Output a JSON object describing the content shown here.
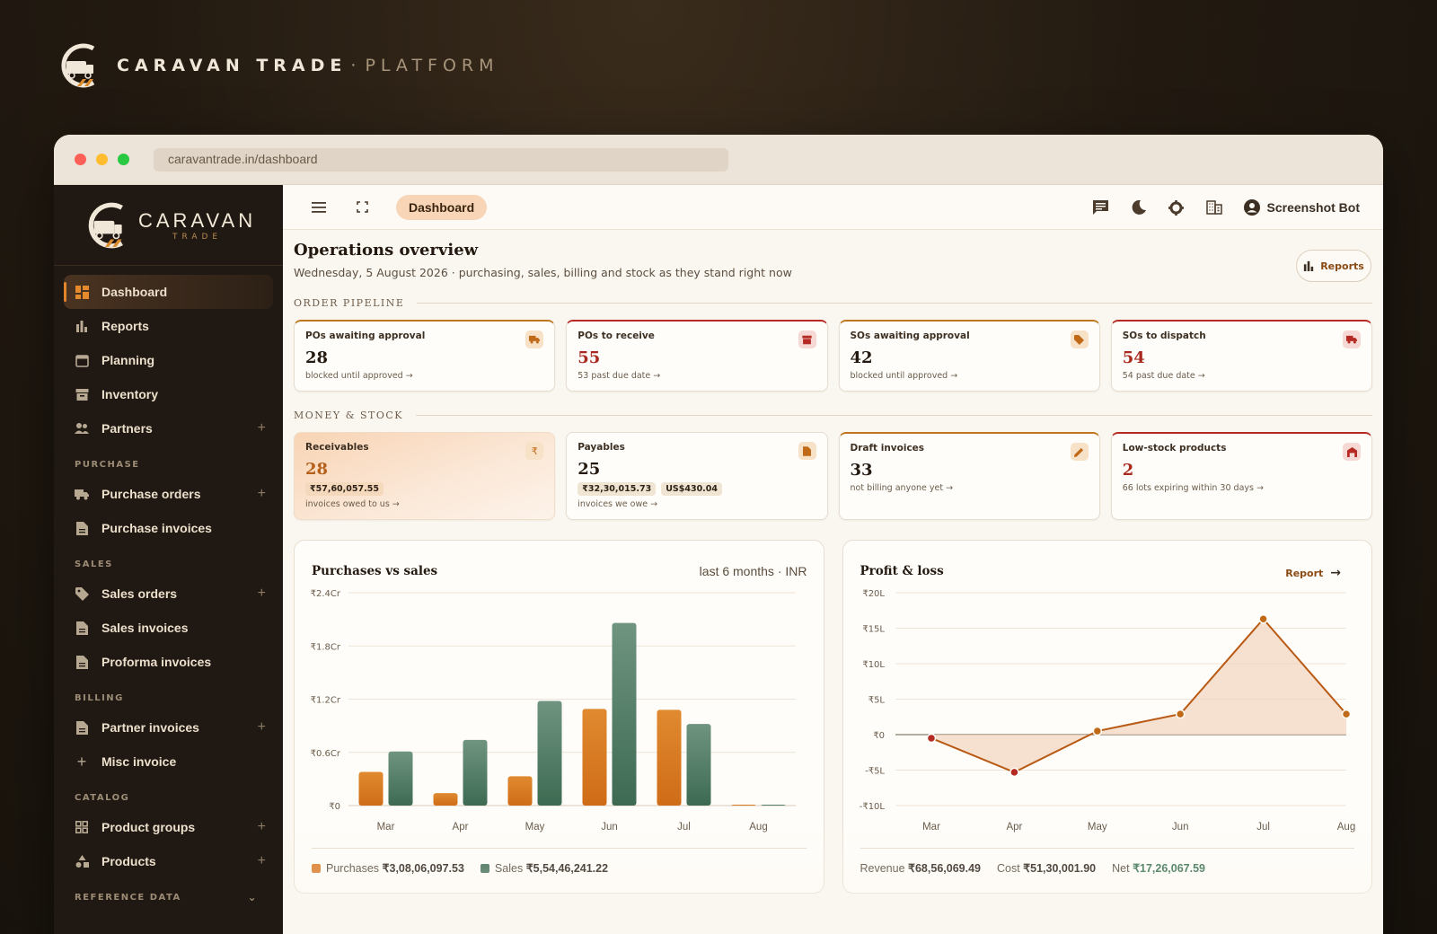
{
  "hero": {
    "brand": "CARAVAN TRADE",
    "separator": "·",
    "suffix": "PLATFORM"
  },
  "browser": {
    "url": "caravantrade.in/dashboard"
  },
  "sidebar": {
    "logo": {
      "name": "CARAVAN",
      "tagline": "TRADE"
    },
    "items_top": [
      {
        "label": "Dashboard",
        "icon": "dashboard-icon",
        "active": true
      },
      {
        "label": "Reports",
        "icon": "bar-chart-icon"
      },
      {
        "label": "Planning",
        "icon": "calendar-icon"
      },
      {
        "label": "Inventory",
        "icon": "archive-icon"
      },
      {
        "label": "Partners",
        "icon": "people-icon",
        "plus": true
      }
    ],
    "sections": {
      "purchase": "PURCHASE",
      "sales": "SALES",
      "billing": "BILLING",
      "catalog": "CATALOG",
      "reference": "REFERENCE DATA"
    },
    "purchase_items": [
      {
        "label": "Purchase orders",
        "icon": "truck-icon",
        "plus": true
      },
      {
        "label": "Purchase invoices",
        "icon": "document-icon"
      }
    ],
    "sales_items": [
      {
        "label": "Sales orders",
        "icon": "tag-icon",
        "plus": true
      },
      {
        "label": "Sales invoices",
        "icon": "document-icon"
      },
      {
        "label": "Proforma invoices",
        "icon": "document-icon"
      }
    ],
    "billing_items": [
      {
        "label": "Partner invoices",
        "icon": "document-icon",
        "plus": true
      },
      {
        "label": "Misc invoice",
        "icon": "plus-icon"
      }
    ],
    "catalog_items": [
      {
        "label": "Product groups",
        "icon": "grid-icon",
        "plus": true
      },
      {
        "label": "Products",
        "icon": "shapes-icon",
        "plus": true
      }
    ]
  },
  "topbar": {
    "tab": "Dashboard",
    "user": "Screenshot Bot"
  },
  "page": {
    "title": "Operations overview",
    "subtitle": "Wednesday, 5 August 2026 · purchasing, sales, billing and stock as they stand right now",
    "reports_button": "Reports"
  },
  "pipeline": {
    "heading": "ORDER PIPELINE",
    "cards": [
      {
        "label": "POs awaiting approval",
        "value": "28",
        "foot": "blocked until approved →",
        "icon": "truck-icon"
      },
      {
        "label": "POs to receive",
        "value": "55",
        "foot": "53 past due date →",
        "icon": "archive-icon"
      },
      {
        "label": "SOs awaiting approval",
        "value": "42",
        "foot": "blocked until approved →",
        "icon": "tag-icon"
      },
      {
        "label": "SOs to dispatch",
        "value": "54",
        "foot": "54 past due date →",
        "icon": "truck-icon"
      }
    ]
  },
  "money": {
    "heading": "MONEY & STOCK",
    "cards": [
      {
        "label": "Receivables",
        "value": "28",
        "tags": [
          "₹57,60,057.55"
        ],
        "foot": "invoices owed to us →",
        "icon": "rupee-icon"
      },
      {
        "label": "Payables",
        "value": "25",
        "tags": [
          "₹32,30,015.73",
          "US$430.04"
        ],
        "foot": "invoices we owe →",
        "icon": "document-icon"
      },
      {
        "label": "Draft invoices",
        "value": "33",
        "foot": "not billing anyone yet →",
        "icon": "pencil-icon"
      },
      {
        "label": "Low-stock products",
        "value": "2",
        "foot": "66 lots expiring within 30 days →",
        "icon": "warehouse-icon"
      }
    ]
  },
  "colors": {
    "purchases": "#d9771f",
    "sales": "#4f7a63",
    "profit_line": "#b85a14",
    "negative_dot": "#b52a22"
  },
  "chart_data": [
    {
      "type": "bar",
      "title": "Purchases vs sales",
      "meta": "last 6 months · INR",
      "categories": [
        "Mar",
        "Apr",
        "May",
        "Jun",
        "Jul",
        "Aug"
      ],
      "y_ticks": [
        "₹0",
        "₹0.6Cr",
        "₹1.2Cr",
        "₹1.8Cr",
        "₹2.4Cr"
      ],
      "ylim": [
        0,
        2.4
      ],
      "unit": "Cr",
      "series": [
        {
          "name": "Purchases",
          "values": [
            0.38,
            0.14,
            0.33,
            1.09,
            1.08,
            0.01
          ],
          "total": "₹3,08,06,097.53"
        },
        {
          "name": "Sales",
          "values": [
            0.61,
            0.74,
            1.18,
            2.06,
            0.92,
            0.01
          ],
          "total": "₹5,54,46,241.22"
        }
      ],
      "grid": true
    },
    {
      "type": "line",
      "title": "Profit & loss",
      "link": "Report",
      "categories": [
        "Mar",
        "Apr",
        "May",
        "Jun",
        "Jul",
        "Aug"
      ],
      "y_ticks": [
        "-₹10L",
        "-₹5L",
        "₹0",
        "₹5L",
        "₹10L",
        "₹15L",
        "₹20L"
      ],
      "ylim": [
        -10,
        20
      ],
      "unit": "L",
      "values": [
        -0.5,
        -5.3,
        0.5,
        2.9,
        16.3,
        2.9
      ],
      "grid": true,
      "summary": {
        "revenue_label": "Revenue",
        "revenue": "₹68,56,069.49",
        "cost_label": "Cost",
        "cost": "₹51,30,001.90",
        "net_label": "Net",
        "net": "₹17,26,067.59"
      }
    }
  ]
}
